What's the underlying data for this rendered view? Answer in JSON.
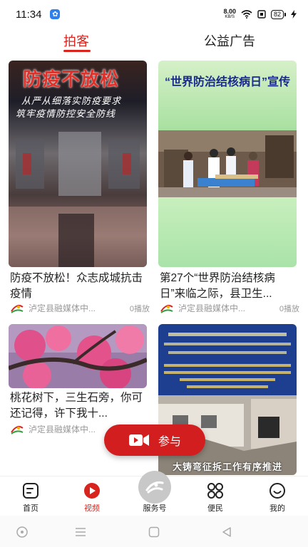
{
  "status": {
    "time": "11:34",
    "net_speed": "8.00",
    "net_unit": "KB/S",
    "battery": "82"
  },
  "tabs": [
    {
      "label": "拍客",
      "active": true
    },
    {
      "label": "公益广告",
      "active": false
    }
  ],
  "cards": [
    {
      "overlay_title": "防疫不放松",
      "overlay_sub1": "从严从细落实防疫要求",
      "overlay_sub2": "筑牢疫情防控安全防线",
      "title": "防疫不放松！众志成城抗击疫情",
      "source": "泸定县融媒体中...",
      "plays": "0播放"
    },
    {
      "overlay_title": "“世界防治结核病日”宣传",
      "title": "第27个“世界防治结核病日”来临之际，县卫生...",
      "source": "泸定县融媒体中...",
      "plays": "0播放"
    },
    {
      "title": "桃花树下，三生石旁，你可还记得，许下我十...",
      "source": "泸定县融媒体中..."
    },
    {
      "overlay_caption": "大铸弯征拆工作有序推进"
    }
  ],
  "fab": {
    "label": "参与"
  },
  "nav": {
    "items": [
      {
        "label": "首页"
      },
      {
        "label": "视频"
      },
      {
        "label": "服务号"
      },
      {
        "label": "便民"
      },
      {
        "label": "我的"
      }
    ]
  },
  "colors": {
    "accent": "#d9231d",
    "text": "#222222",
    "muted": "#999999"
  }
}
